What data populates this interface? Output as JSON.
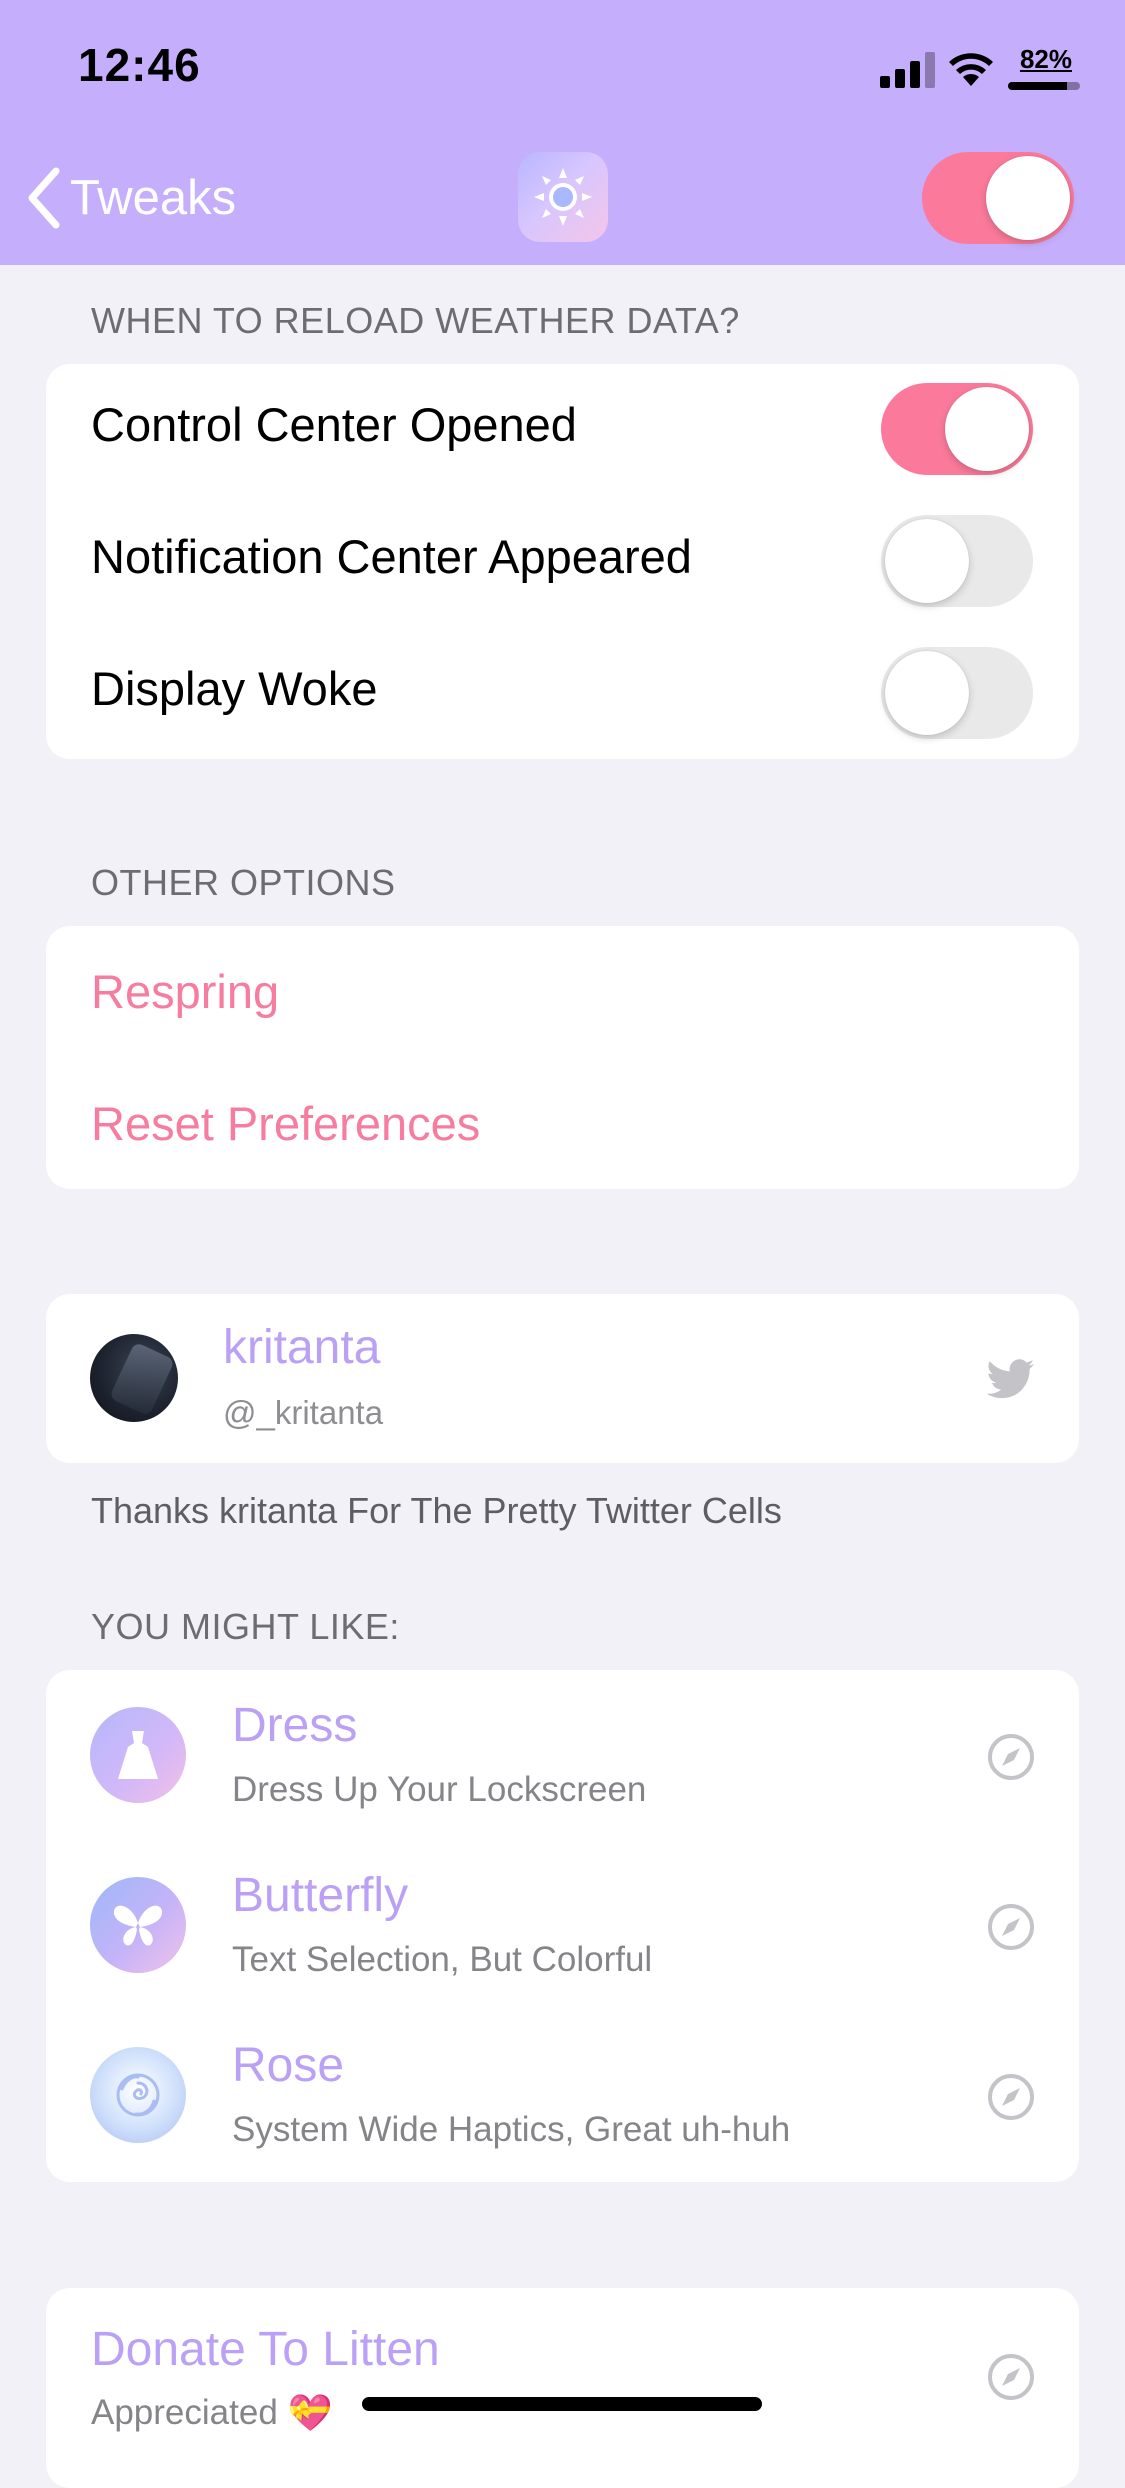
{
  "status_bar": {
    "time": "12:46",
    "battery_percent": "82%",
    "battery_level": 0.82
  },
  "nav": {
    "back_label": "Tweaks",
    "app_icon": "sun-icon",
    "master_toggle_on": true
  },
  "reload_section": {
    "header": "WHEN TO RELOAD WEATHER DATA?",
    "items": [
      {
        "label": "Control Center Opened",
        "on": true
      },
      {
        "label": "Notification Center Appeared",
        "on": false
      },
      {
        "label": "Display Woke",
        "on": false
      }
    ]
  },
  "other_section": {
    "header": "OTHER OPTIONS",
    "items": [
      {
        "label": "Respring"
      },
      {
        "label": "Reset Preferences"
      }
    ]
  },
  "twitter": {
    "name": "kritanta",
    "handle": "@_kritanta",
    "icon": "twitter-bird-icon",
    "footer": "Thanks kritanta For The Pretty Twitter Cells"
  },
  "might_like": {
    "header": "YOU MIGHT LIKE:",
    "items": [
      {
        "title": "Dress",
        "subtitle": "Dress Up Your Lockscreen",
        "icon": "dress-icon"
      },
      {
        "title": "Butterfly",
        "subtitle": "Text Selection, But Colorful",
        "icon": "butterfly-icon"
      },
      {
        "title": "Rose",
        "subtitle": "System Wide Haptics, Great uh-huh",
        "icon": "rose-icon"
      }
    ]
  },
  "donate": {
    "title": "Donate To Litten",
    "subtitle": "Appreciated",
    "emoji": "💝"
  },
  "colors": {
    "header_bg": "#c5aefb",
    "accent_pink": "#fb7a9b",
    "accent_purple": "#bba1f5",
    "page_bg": "#f2f1f7"
  }
}
